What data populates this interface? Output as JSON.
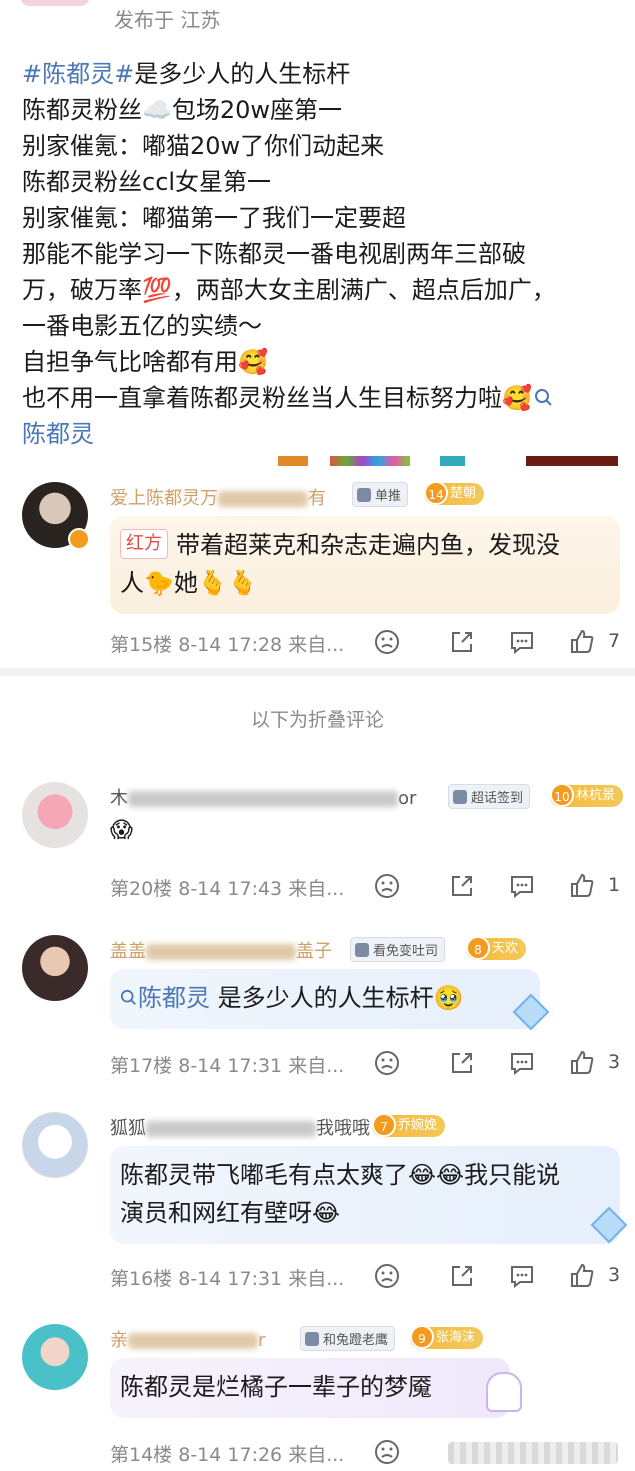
{
  "header": {
    "posted_from": "发布于 江苏"
  },
  "post": {
    "lines": [
      {
        "topic": "#陈都灵#",
        "text": "是多少人的人生标杆"
      },
      {
        "text": "陈都灵粉丝☁️包场20w座第一"
      },
      {
        "text": "别家催氪：嘟猫20w了你们动起来"
      },
      {
        "text": "陈都灵粉丝ccl女星第一"
      },
      {
        "text": "别家催氪：嘟猫第一了我们一定要超"
      },
      {
        "text": "那能不能学习一下陈都灵一番电视剧两年三部破"
      },
      {
        "text": "万，破万率💯，两部大女主剧满广、超点后加广，"
      },
      {
        "text": "一番电影五亿的实绩～"
      },
      {
        "text": "自担争气比啥都有用🥰"
      },
      {
        "text": "也不用一直拿着陈都灵粉丝当人生目标努力啦🥰"
      }
    ],
    "search_link": "陈都灵"
  },
  "fold_label": "以下为折叠评论",
  "comments": [
    {
      "user": "爱上陈都灵万",
      "user_tail": "有",
      "badge": "单推",
      "fan_level": "14",
      "fan_name": "楚朝",
      "tag": "红方",
      "text_line1": "带着超莱克和杂志走遍内鱼，发现没",
      "text_line2": "人🐤她🫰🫰",
      "floor": "第15楼",
      "time": "8-14 17:28",
      "from": "来自...",
      "likes": "7"
    },
    {
      "user": "木",
      "user_tail": "or",
      "badge": "超话签到",
      "fan_level": "10",
      "fan_name": "林杭景",
      "text_line1": "😱",
      "floor": "第20楼",
      "time": "8-14 17:43",
      "from": "来自...",
      "likes": "1"
    },
    {
      "user": "盖盖",
      "user_tail": "盖子",
      "badge": "看免变吐司",
      "fan_level": "8",
      "fan_name": "天欢",
      "link": "陈都灵",
      "text_line1": " 是多少人的人生标杆🥹",
      "floor": "第17楼",
      "time": "8-14 17:31",
      "from": "来自...",
      "likes": "3"
    },
    {
      "user": "狐狐",
      "user_tail": "我哦哦",
      "fan_level": "7",
      "fan_name": "乔婉娩",
      "text_line1": "陈都灵带飞嘟毛有点太爽了😂😂我只能说",
      "text_line2": "演员和网红有壁呀😂",
      "floor": "第16楼",
      "time": "8-14 17:31",
      "from": "来自...",
      "likes": "3"
    },
    {
      "user": "亲",
      "user_tail": "r",
      "badge": "和兔蹬老鹰",
      "fan_level": "9",
      "fan_name": "张海沫",
      "text_line1": "陈都灵是烂橘子一辈子的梦魇",
      "floor": "第14楼",
      "time": "8-14 17:26",
      "from": "来自..."
    }
  ],
  "colors": {
    "link": "#4a77b5",
    "gold": "#d0a06a",
    "meta": "#8a8a8a"
  }
}
